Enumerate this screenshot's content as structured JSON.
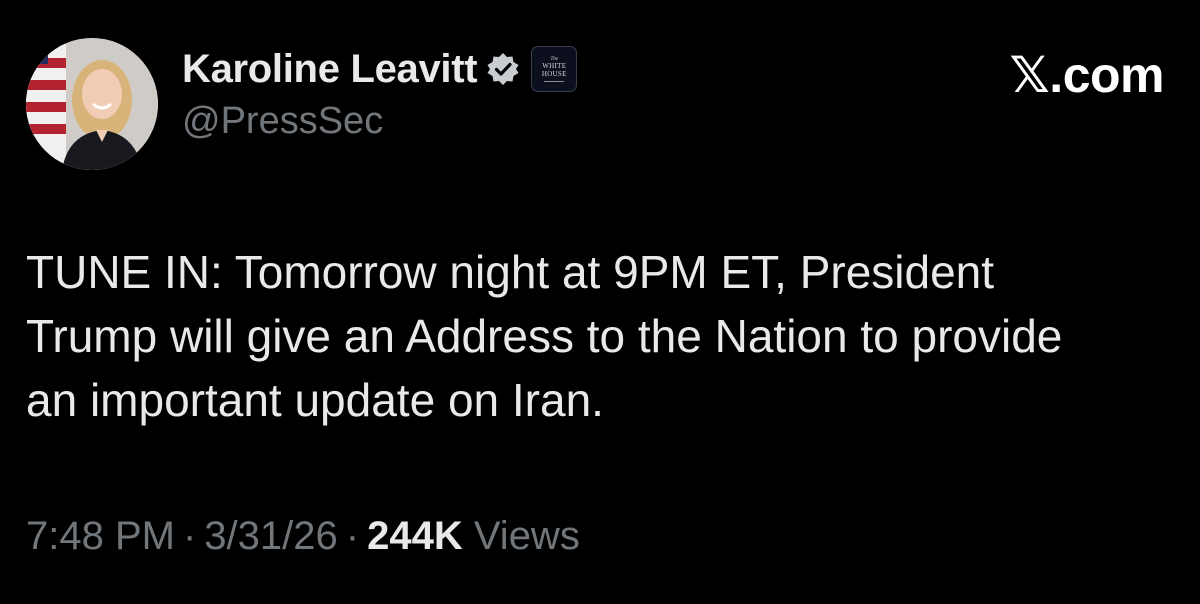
{
  "brand": {
    "label": "𝕏.com"
  },
  "author": {
    "display_name": "Karoline Leavitt",
    "handle": "@PressSec",
    "verified_badge_color": "#1d9bf0",
    "affiliate_badge": {
      "small": "The",
      "line1": "WHITE",
      "line2": "HOUSE"
    }
  },
  "tweet": {
    "lines": [
      "TUNE IN: Tomorrow night at 9PM ET, President",
      "Trump will give an Address to the Nation to provide",
      "an important update on Iran."
    ]
  },
  "meta": {
    "time": "7:48 PM",
    "separator": "·",
    "date": "3/31/26",
    "views_count": "244K",
    "views_label": "Views"
  },
  "colors": {
    "background": "#000000",
    "primary_text": "#e7e9ea",
    "secondary_text": "#71767b"
  }
}
